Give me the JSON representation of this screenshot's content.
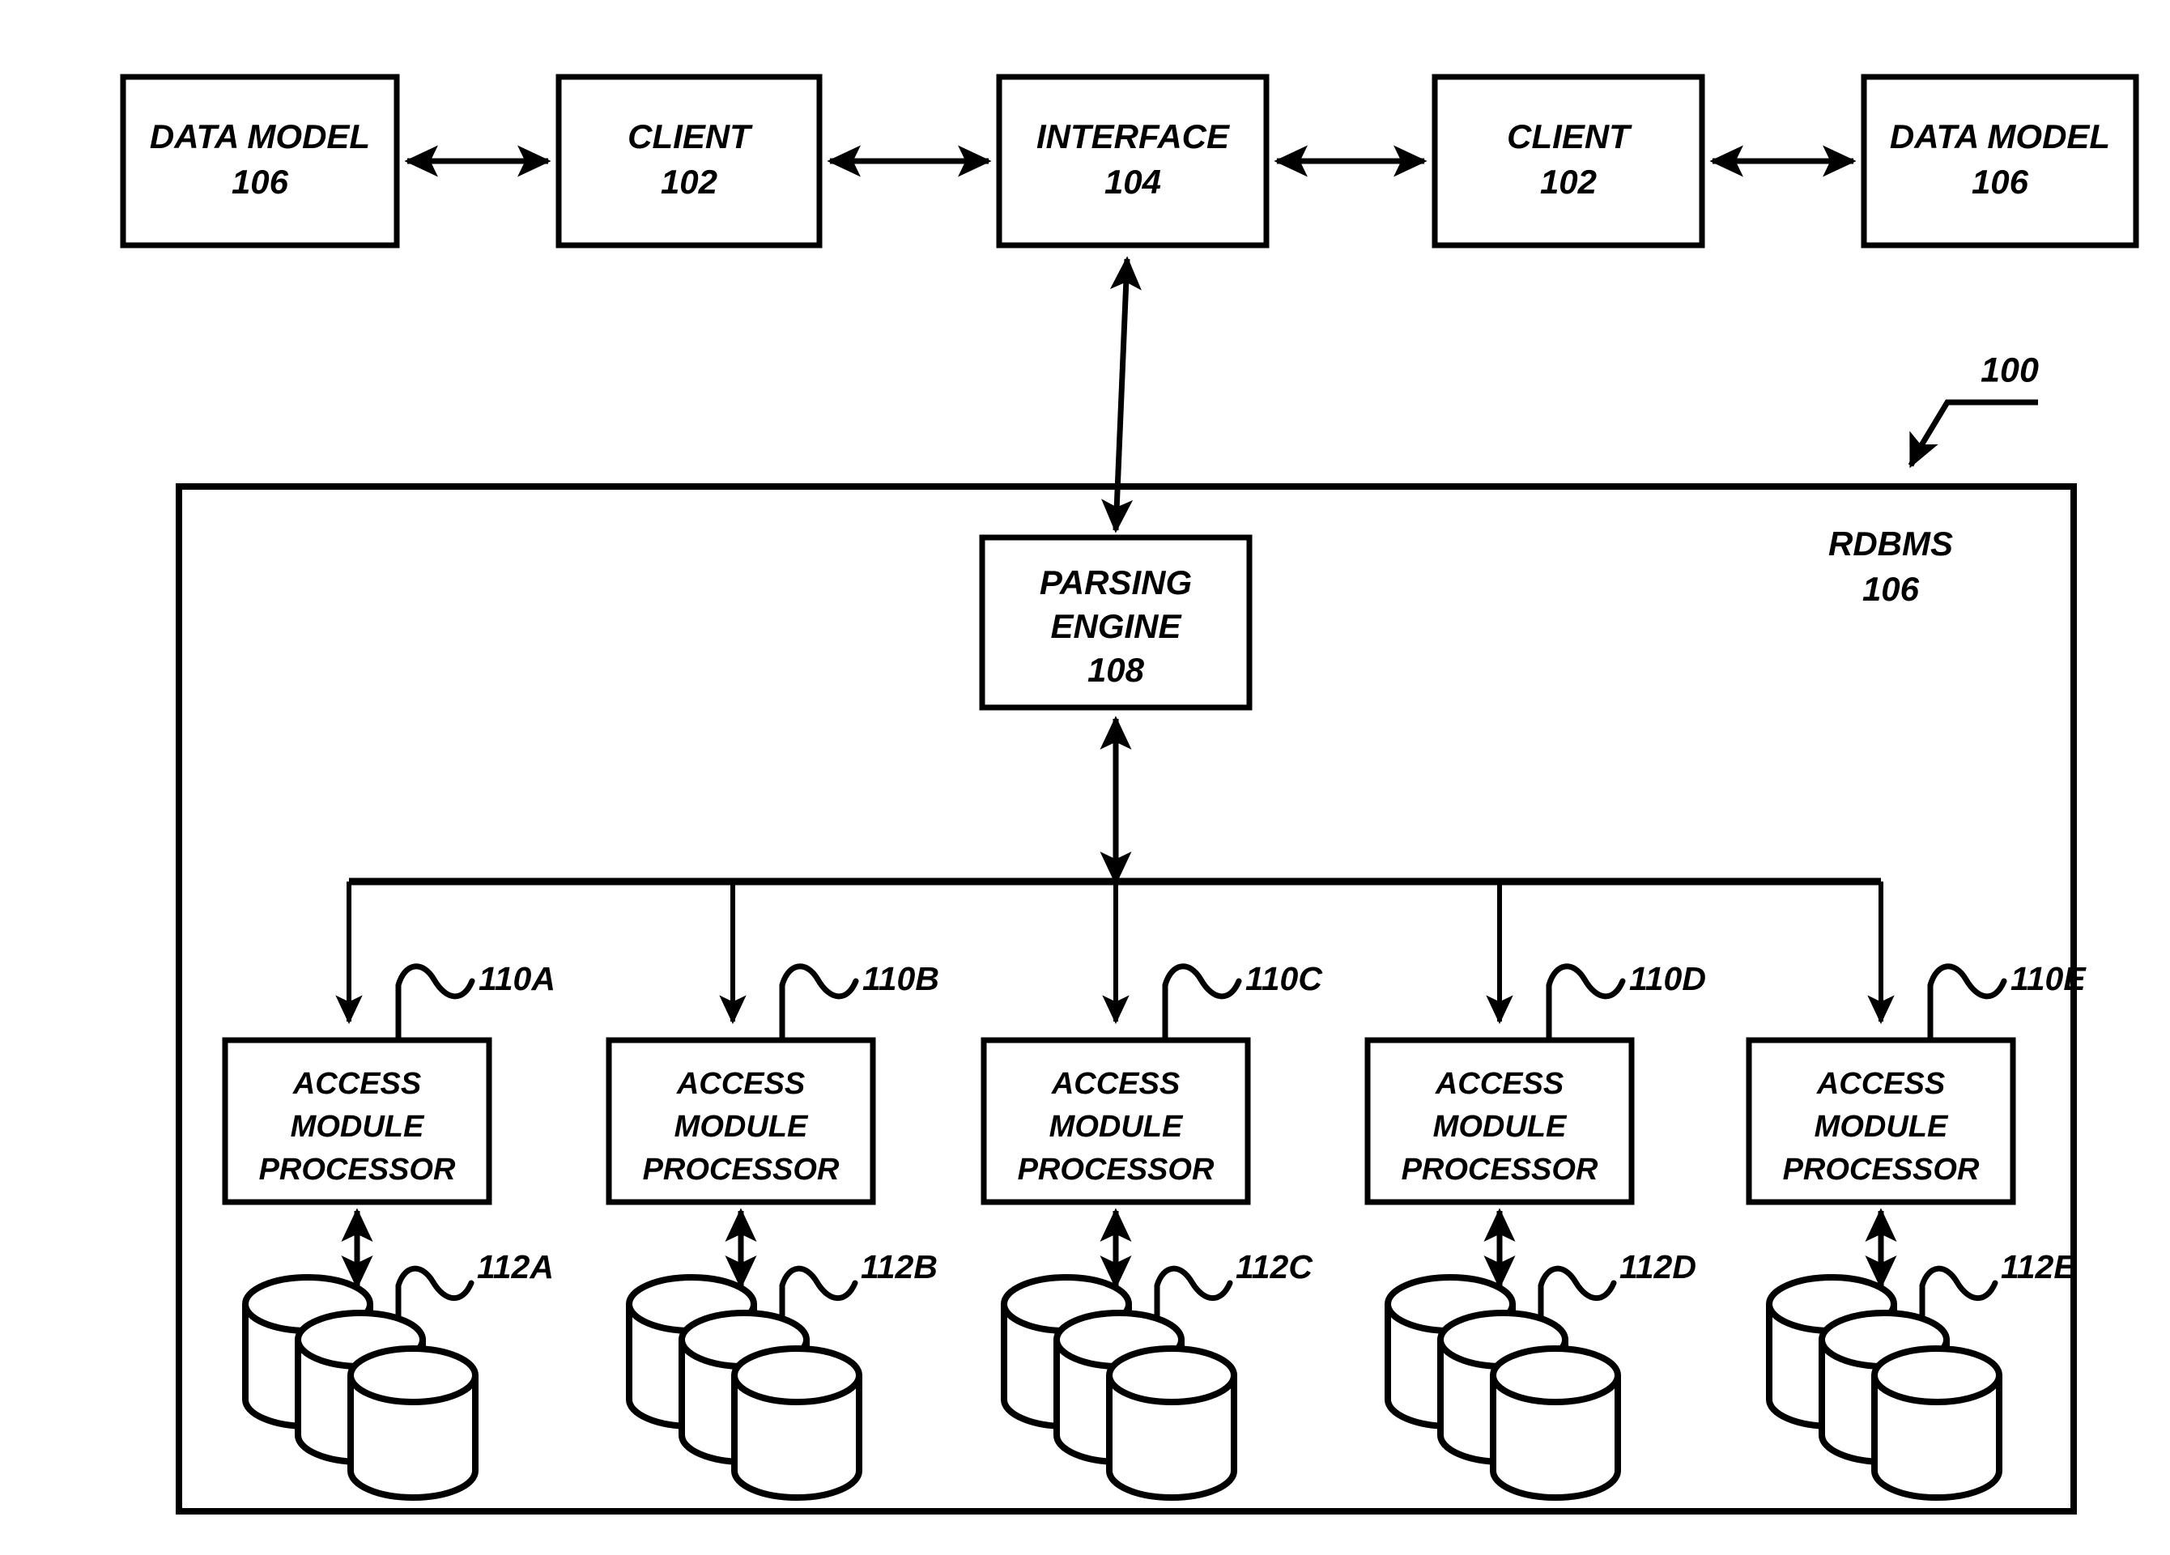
{
  "figure": {
    "reference_numeral": "100",
    "container": {
      "name": "RDBMS",
      "numeral": "106"
    }
  },
  "top_row": {
    "nodes": [
      {
        "id": "data-model-left",
        "lines": [
          "DATA MODEL",
          "106"
        ]
      },
      {
        "id": "client-left",
        "lines": [
          "CLIENT",
          "102"
        ]
      },
      {
        "id": "interface",
        "lines": [
          "INTERFACE",
          "104"
        ]
      },
      {
        "id": "client-right",
        "lines": [
          "CLIENT",
          "102"
        ]
      },
      {
        "id": "data-model-right",
        "lines": [
          "DATA MODEL",
          "106"
        ]
      }
    ],
    "connector_type": "double-headed-arrow"
  },
  "parsing_engine": {
    "lines": [
      "PARSING",
      "ENGINE",
      "108"
    ]
  },
  "access_modules": [
    {
      "label_lines": [
        "ACCESS",
        "MODULE",
        "PROCESSOR"
      ],
      "numeral": "110A",
      "storage_numeral": "112A"
    },
    {
      "label_lines": [
        "ACCESS",
        "MODULE",
        "PROCESSOR"
      ],
      "numeral": "110B",
      "storage_numeral": "112B"
    },
    {
      "label_lines": [
        "ACCESS",
        "MODULE",
        "PROCESSOR"
      ],
      "numeral": "110C",
      "storage_numeral": "112C"
    },
    {
      "label_lines": [
        "ACCESS",
        "MODULE",
        "PROCESSOR"
      ],
      "numeral": "110D",
      "storage_numeral": "112D"
    },
    {
      "label_lines": [
        "ACCESS",
        "MODULE",
        "PROCESSOR"
      ],
      "numeral": "110E",
      "storage_numeral": "112E"
    }
  ],
  "storage": {
    "symbol": "disk-stack-three-cylinders",
    "count_per_module": 3
  },
  "colors": {
    "stroke": "#000000",
    "fill": "#ffffff",
    "background": "#ffffff"
  }
}
